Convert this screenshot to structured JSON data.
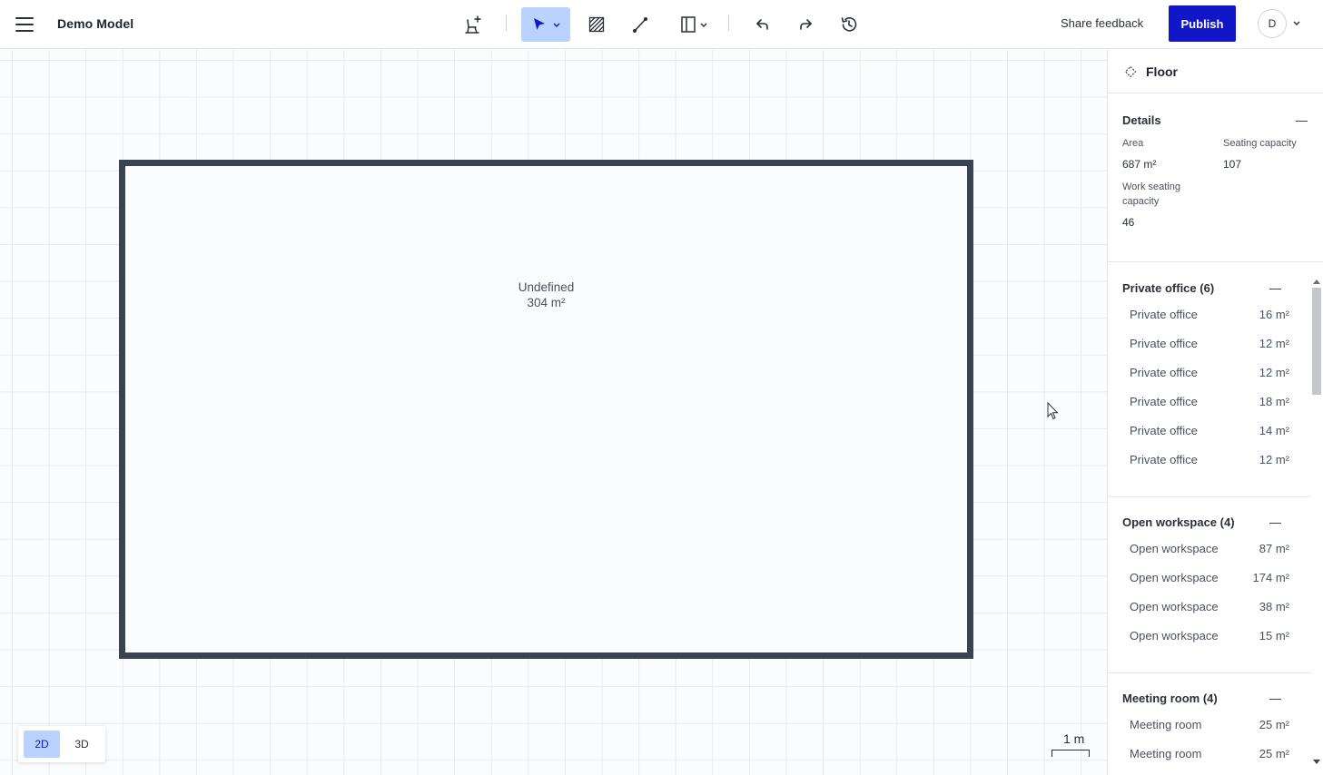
{
  "header": {
    "title": "Demo Model",
    "share_feedback": "Share feedback",
    "publish": "Publish",
    "avatar_initial": "D"
  },
  "toolbar": {
    "tools": [
      {
        "icon": "add-furniture-icon",
        "active": false
      },
      {
        "icon": "select-pointer-icon",
        "active": true
      },
      {
        "icon": "hatch-area-icon",
        "active": false
      },
      {
        "icon": "draw-line-icon",
        "active": false
      },
      {
        "icon": "door-window-icon",
        "active": false
      },
      {
        "icon": "undo-icon",
        "active": false
      },
      {
        "icon": "redo-icon",
        "active": false
      },
      {
        "icon": "history-icon",
        "active": false
      }
    ],
    "active_color": "#b9d2ff"
  },
  "canvas": {
    "room_name": "Undefined",
    "room_area": "304 m²",
    "view_modes": [
      "2D",
      "3D"
    ],
    "active_view": "2D",
    "scale_label": "1 m"
  },
  "panel": {
    "header_title": "Floor",
    "details": {
      "title": "Details",
      "area_label": "Area",
      "area_value": "687 m²",
      "seating_label": "Seating capacity",
      "seating_value": "107",
      "work_seating_label": "Work seating capacity",
      "work_seating_value": "46"
    },
    "groups": [
      {
        "title": "Private office (6)",
        "items": [
          {
            "name": "Private office",
            "area": "16 m²"
          },
          {
            "name": "Private office",
            "area": "12 m²"
          },
          {
            "name": "Private office",
            "area": "12 m²"
          },
          {
            "name": "Private office",
            "area": "18 m²"
          },
          {
            "name": "Private office",
            "area": "14 m²"
          },
          {
            "name": "Private office",
            "area": "12 m²"
          }
        ]
      },
      {
        "title": "Open workspace (4)",
        "items": [
          {
            "name": "Open workspace",
            "area": "87 m²"
          },
          {
            "name": "Open workspace",
            "area": "174 m²"
          },
          {
            "name": "Open workspace",
            "area": "38 m²"
          },
          {
            "name": "Open workspace",
            "area": "15 m²"
          }
        ]
      },
      {
        "title": "Meeting room (4)",
        "items": [
          {
            "name": "Meeting room",
            "area": "25 m²"
          },
          {
            "name": "Meeting room",
            "area": "25 m²"
          }
        ]
      }
    ]
  },
  "colors": {
    "brand": "#1216c9",
    "wall": "#3b4252",
    "grid": "#e8ebef"
  }
}
